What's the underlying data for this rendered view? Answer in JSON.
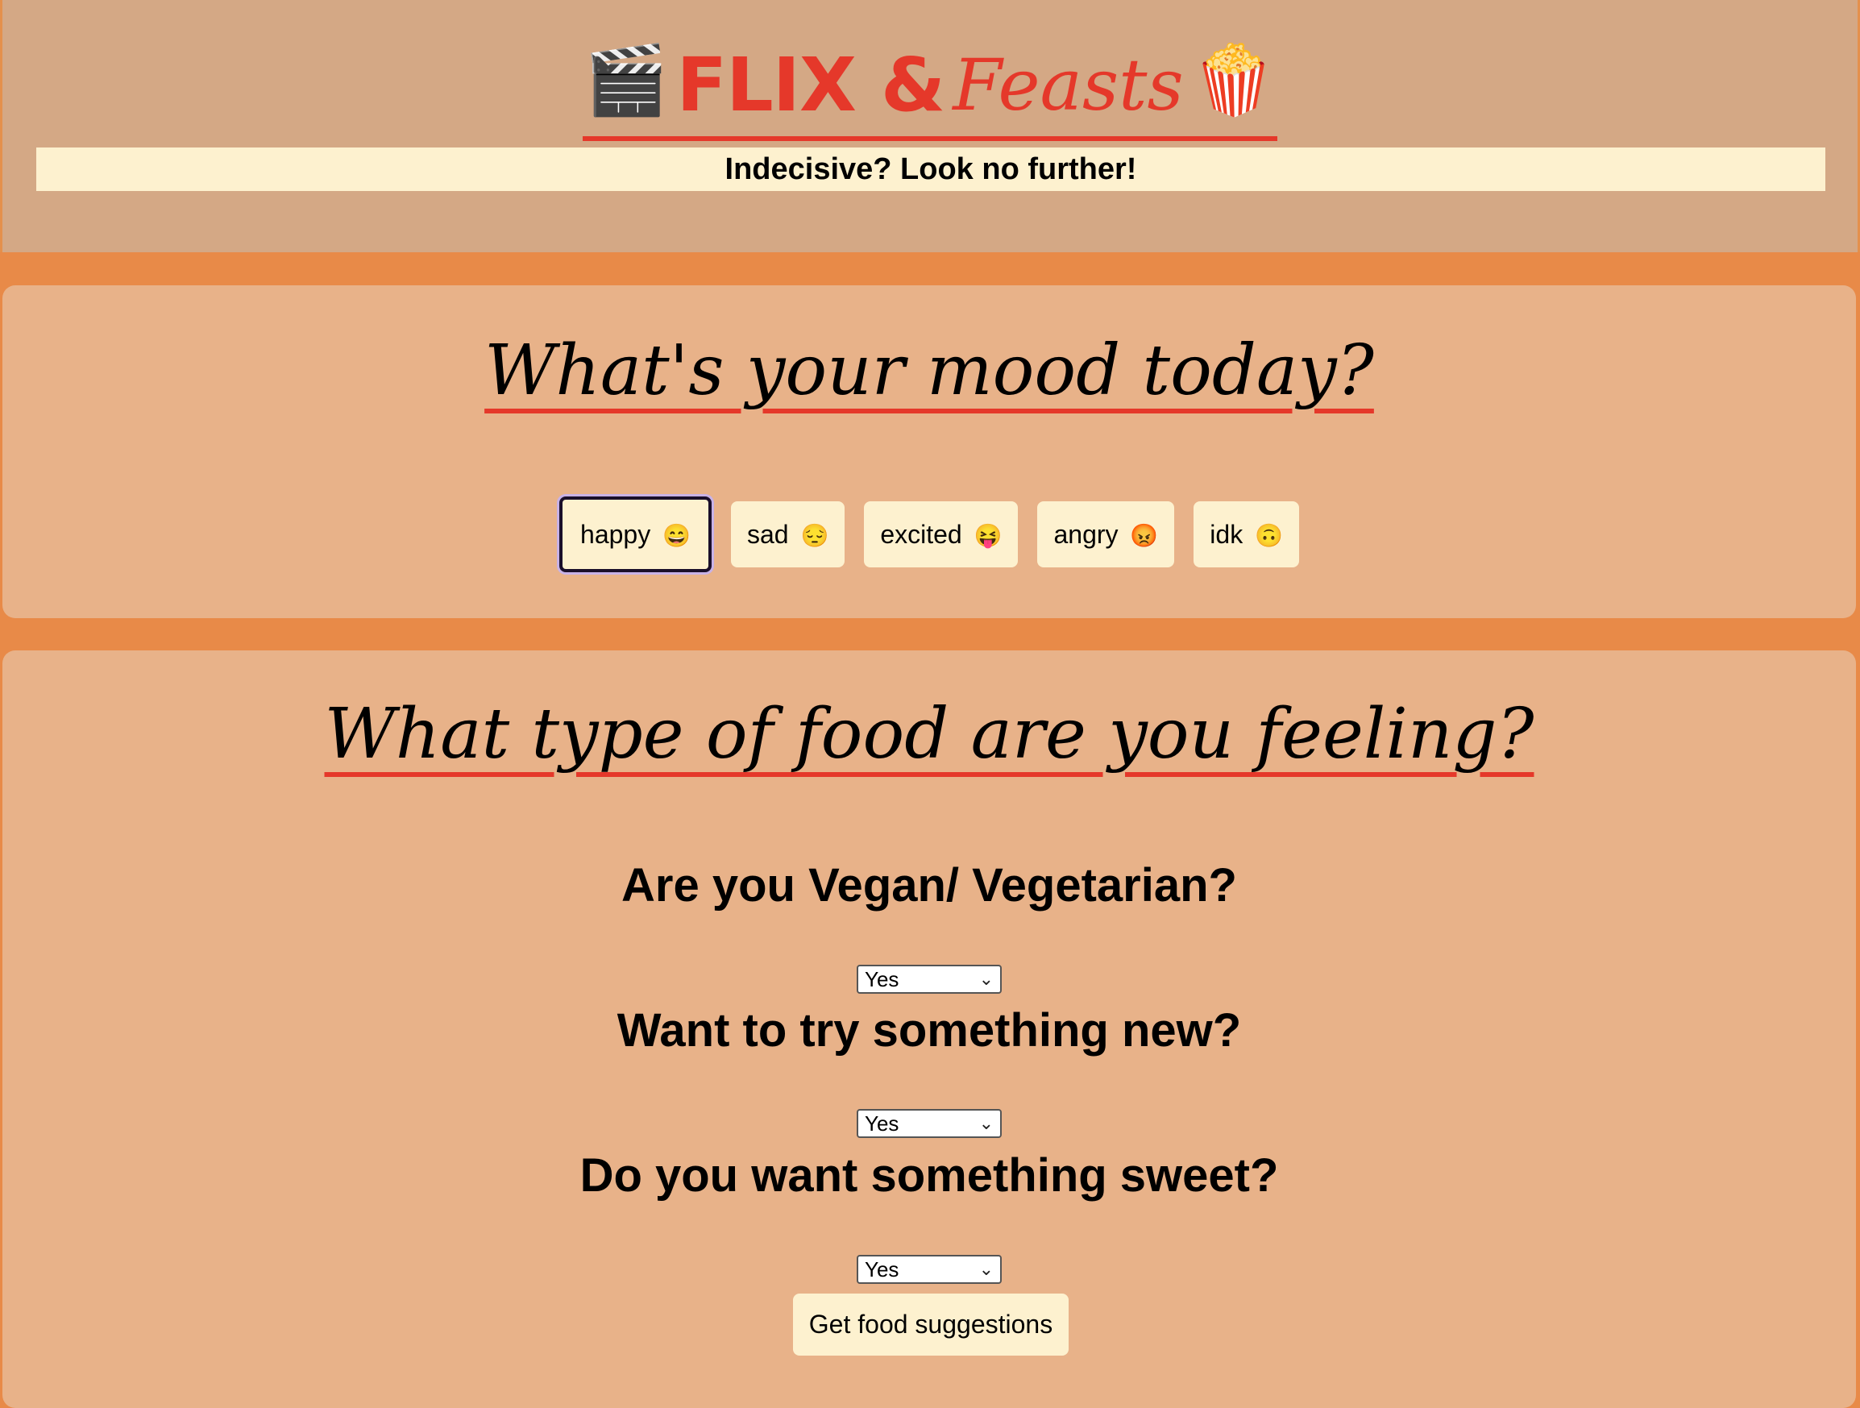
{
  "header": {
    "logo_left_emoji": "🎬",
    "logo_flix": "FLIX &",
    "logo_feasts": "Feasts",
    "logo_right_emoji": "🍿",
    "tagline": "Indecisive? Look no further!"
  },
  "mood": {
    "title": "What's your mood today?",
    "options": [
      {
        "label": "happy",
        "emoji": "😄",
        "selected": true
      },
      {
        "label": "sad",
        "emoji": "😔",
        "selected": false
      },
      {
        "label": "excited",
        "emoji": "😝",
        "selected": false
      },
      {
        "label": "angry",
        "emoji": "😡",
        "selected": false
      },
      {
        "label": "idk",
        "emoji": "🙃",
        "selected": false
      }
    ]
  },
  "food": {
    "title": "What type of food are you feeling?",
    "questions": [
      {
        "label": "Are you Vegan/ Vegetarian?",
        "value": "Yes"
      },
      {
        "label": "Want to try something new?",
        "value": "Yes"
      },
      {
        "label": "Do you want something sweet?",
        "value": "Yes"
      }
    ],
    "submit_label": "Get food suggestions"
  },
  "colors": {
    "accent_red": "#e5382a",
    "cream": "#fdf1cf",
    "header_bg": "#d4a885",
    "card_bg": "#e8b289",
    "page_bg": "#e88a48"
  }
}
